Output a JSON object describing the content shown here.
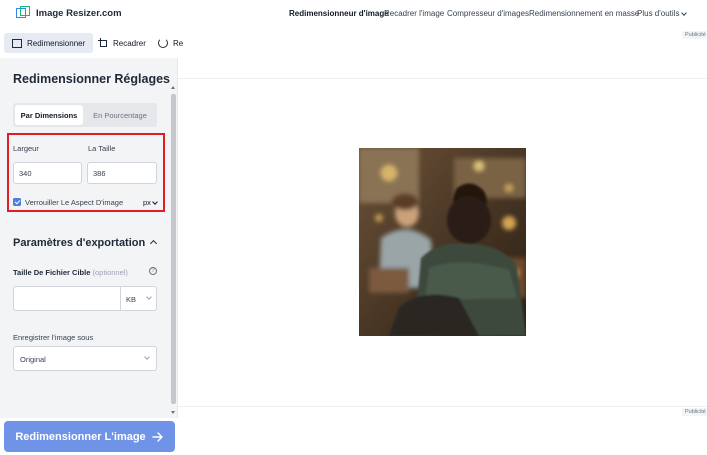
{
  "header": {
    "logo_text": "Image Resizer.com",
    "nav": [
      {
        "label": "Redimensionneur d'image",
        "active": true
      },
      {
        "label": "Recadrer l'image"
      },
      {
        "label": "Compresseur d'images"
      },
      {
        "label": "Redimensionnement en masse"
      },
      {
        "label": "Plus d'outils"
      }
    ]
  },
  "tool_tabs": [
    {
      "label": "Redimensionner",
      "icon": "resize-icon",
      "active": true
    },
    {
      "label": "Recadrer",
      "icon": "crop-icon"
    },
    {
      "label": "Re",
      "icon": "rotate-icon"
    }
  ],
  "panel": {
    "title": "Redimensionner Réglages",
    "modes": [
      "Par Dimensions",
      "En Pourcentage"
    ],
    "width_label": "Largeur",
    "width_value": "340",
    "height_label": "La Taille",
    "height_value": "386",
    "lock_label": "Verrouiller Le Aspect D'image",
    "lock_checked": true,
    "unit": "px",
    "export_title": "Paramètres d'exportation",
    "target_label": "Taille De Fichier Cible",
    "target_optional": "(optionnel)",
    "target_value": "",
    "target_unit": "KB",
    "save_label": "Enregistrer l'image sous",
    "save_value": "Original"
  },
  "cta_label": "Redimensionner L'image",
  "ads": {
    "top": "Publicité",
    "bottom": "Publicité"
  },
  "colors": {
    "accent": "#6f93e6",
    "highlight": "#e11d24",
    "checkbox": "#4f7fd8"
  }
}
